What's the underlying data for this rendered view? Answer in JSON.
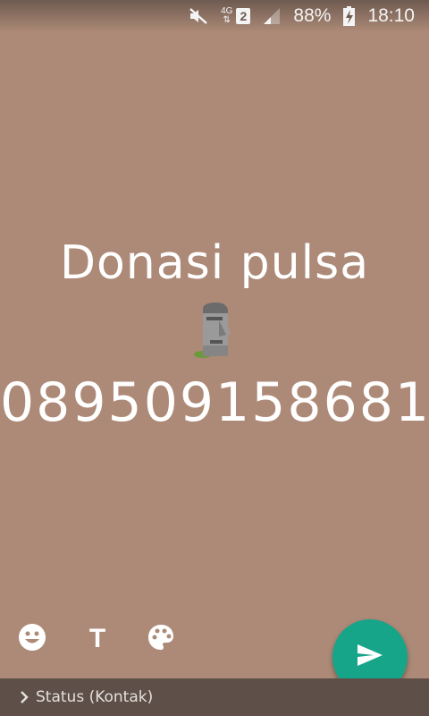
{
  "statusbar": {
    "network_type": "4G",
    "sim_number": "2",
    "battery": "88%",
    "time": "18:10",
    "icons": [
      "mute-icon",
      "signal-icon",
      "battery-charging-icon"
    ]
  },
  "status_text": {
    "line1": "Donasi pulsa",
    "emoji": "moai-emoji",
    "line2": "089509158681"
  },
  "toolbar": {
    "emoji_icon": "smiley-icon",
    "text_label": "T",
    "palette_icon": "palette-icon"
  },
  "send_button": {
    "icon": "send-icon"
  },
  "bottom_bar": {
    "label": "Status (Kontak)"
  },
  "colors": {
    "background": "#ad8a77",
    "send": "#17a58a",
    "bottom_bar": "#5e4f48"
  }
}
